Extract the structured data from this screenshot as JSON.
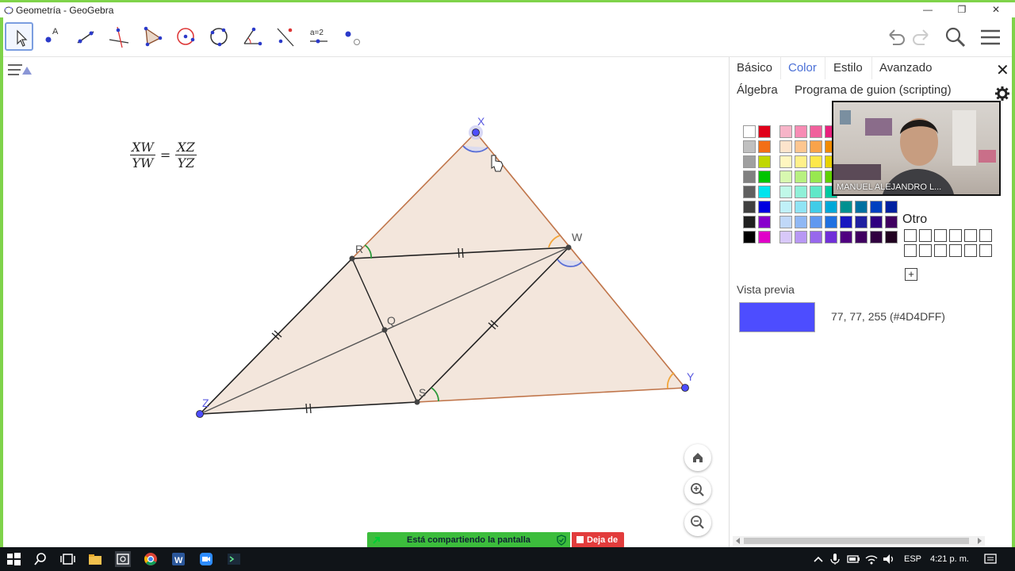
{
  "window": {
    "title": "Geometría - GeoGebra",
    "minimize": "—",
    "restore": "❐",
    "close": "✕"
  },
  "toolbar": {
    "tools": [
      "move",
      "point",
      "line",
      "perpendicular-line",
      "polygon",
      "circle-center-point",
      "circle-three-points",
      "angle",
      "reflect",
      "slider",
      "show-hide"
    ],
    "slider_label": "a=2"
  },
  "graphics": {
    "formula": {
      "num1": "XW",
      "den1": "YW",
      "eq": "=",
      "num2": "XZ",
      "den2": "YZ"
    },
    "points": {
      "X": "X",
      "W": "W",
      "Y": "Y",
      "R": "R",
      "Q": "Q",
      "S": "S",
      "Z": "Z"
    },
    "colors": {
      "fill": "#f3e6dc",
      "edge_brown": "#c0754a",
      "edge_black": "#222222",
      "point_blue": "#4d4dff",
      "angle_blue": "#5a6fd6",
      "angle_orange": "#f2a53a",
      "angle_green": "#2d9a3c"
    }
  },
  "panel": {
    "tabs": [
      "Básico",
      "Color",
      "Estilo",
      "Avanzado"
    ],
    "tabs2": [
      "Álgebra",
      "Programa de guion (scripting)"
    ],
    "active_tab": "Color",
    "otro_label": "Otro",
    "add_label": "+",
    "preview_label": "Vista previa",
    "preview_color": "#4D4DFF",
    "rgb_text": "77, 77, 255 (#4D4DFF)"
  },
  "webcam": {
    "label": "MANUEL ALEJANDRO L..."
  },
  "share_bar": {
    "sharing_text": "Está compartiendo la pantalla",
    "stop_text": "Deja de"
  },
  "taskbar": {
    "language": "ESP",
    "time": "4:21 p. m."
  }
}
